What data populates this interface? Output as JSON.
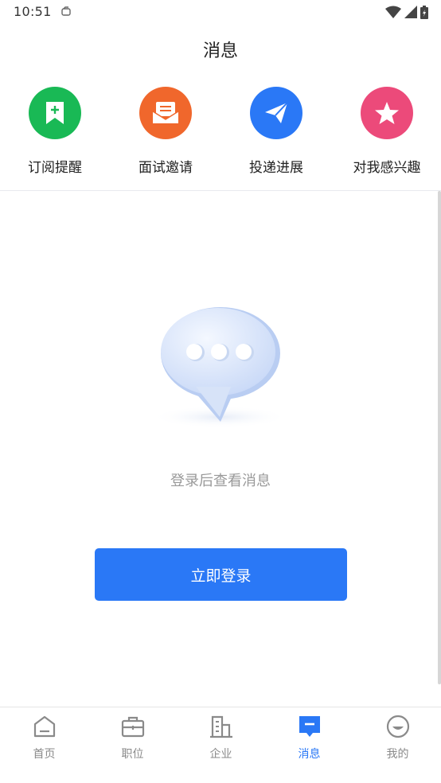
{
  "status_bar": {
    "time": "10:51",
    "icons": [
      "notification-icon",
      "wifi-icon",
      "signal-icon",
      "battery-icon"
    ]
  },
  "header": {
    "title": "消息"
  },
  "quick_entries": [
    {
      "label": "订阅提醒",
      "icon": "bookmark-plus-icon",
      "color": "#19b955"
    },
    {
      "label": "面试邀请",
      "icon": "mail-icon",
      "color": "#f0672c"
    },
    {
      "label": "投递进展",
      "icon": "paper-plane-icon",
      "color": "#2a78f6"
    },
    {
      "label": "对我感兴趣",
      "icon": "star-icon",
      "color": "#ec4a7a"
    }
  ],
  "empty_state": {
    "icon": "chat-bubble-icon",
    "text": "登录后查看消息",
    "button_label": "立即登录"
  },
  "bottom_nav": {
    "active_index": 3,
    "items": [
      {
        "label": "首页",
        "icon": "home-icon"
      },
      {
        "label": "职位",
        "icon": "briefcase-icon"
      },
      {
        "label": "企业",
        "icon": "building-icon"
      },
      {
        "label": "消息",
        "icon": "message-icon"
      },
      {
        "label": "我的",
        "icon": "profile-icon"
      }
    ]
  },
  "colors": {
    "accent": "#2a78f6",
    "inactive_nav": "#8a8a8a",
    "hint_text": "#999999"
  }
}
